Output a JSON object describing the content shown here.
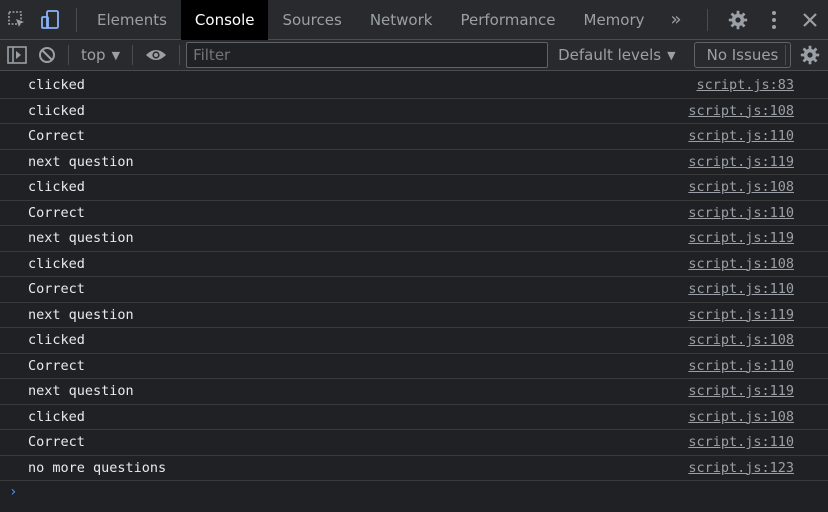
{
  "tabs": [
    {
      "label": "Elements"
    },
    {
      "label": "Console"
    },
    {
      "label": "Sources"
    },
    {
      "label": "Network"
    },
    {
      "label": "Performance"
    },
    {
      "label": "Memory"
    }
  ],
  "more_tabs": "»",
  "toolbar": {
    "context": "top",
    "filter_placeholder": "Filter",
    "levels": "Default levels",
    "issues": "No Issues"
  },
  "logs": [
    {
      "message": "clicked",
      "source": "script.js:83"
    },
    {
      "message": "clicked",
      "source": "script.js:108"
    },
    {
      "message": "Correct",
      "source": "script.js:110"
    },
    {
      "message": "next question",
      "source": "script.js:119"
    },
    {
      "message": "clicked",
      "source": "script.js:108"
    },
    {
      "message": "Correct",
      "source": "script.js:110"
    },
    {
      "message": "next question",
      "source": "script.js:119"
    },
    {
      "message": "clicked",
      "source": "script.js:108"
    },
    {
      "message": "Correct",
      "source": "script.js:110"
    },
    {
      "message": "next question",
      "source": "script.js:119"
    },
    {
      "message": "clicked",
      "source": "script.js:108"
    },
    {
      "message": "Correct",
      "source": "script.js:110"
    },
    {
      "message": "next question",
      "source": "script.js:119"
    },
    {
      "message": "clicked",
      "source": "script.js:108"
    },
    {
      "message": "Correct",
      "source": "script.js:110"
    },
    {
      "message": "no more questions",
      "source": "script.js:123"
    }
  ],
  "prompt_symbol": "›",
  "colors": {
    "accent": "#4d90fe",
    "background": "#202124",
    "toolbar": "#292a2d"
  }
}
